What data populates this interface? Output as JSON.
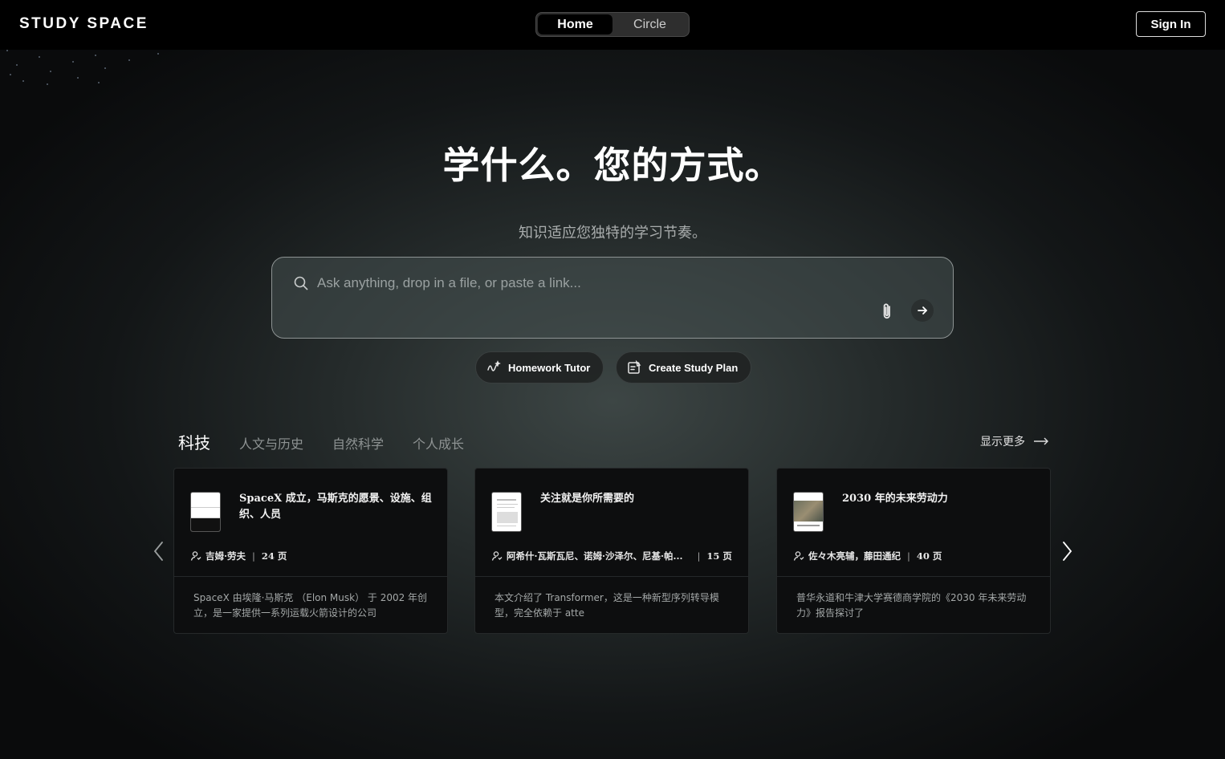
{
  "header": {
    "logo": "STUDY SPACE",
    "tabs": [
      {
        "label": "Home",
        "active": true
      },
      {
        "label": "Circle",
        "active": false
      }
    ],
    "sign_in": "Sign In"
  },
  "hero": {
    "title": "学什么。您的方式。",
    "subtitle": "知识适应您独特的学习节奏。"
  },
  "search": {
    "placeholder": "Ask anything, drop in a file, or paste a link..."
  },
  "chips": [
    {
      "label": "Homework Tutor",
      "icon": "tutor-icon"
    },
    {
      "label": "Create Study Plan",
      "icon": "study-plan-icon"
    }
  ],
  "categories": [
    {
      "label": "科技",
      "active": true
    },
    {
      "label": "人文与历史",
      "active": false
    },
    {
      "label": "自然科学",
      "active": false
    },
    {
      "label": "个人成长",
      "active": false
    }
  ],
  "show_more": "显示更多",
  "cards": [
    {
      "title": "SpaceX 成立，马斯克的愿景、设施、组织、人员",
      "author": "吉姆·劳夫",
      "pages": "24 页",
      "desc": "SpaceX 由埃隆·马斯克 （Elon Musk） 于 2002 年创立，是一家提供一系列运载火箭设计的公司"
    },
    {
      "title": "关注就是你所需要的",
      "author": "阿希什·瓦斯瓦尼、诺姆·沙泽尔、尼基·帕...",
      "pages": "15 页",
      "desc": "本文介绍了 Transformer，这是一种新型序列转导模型，完全依赖于 atte"
    },
    {
      "title": "2030 年的未来劳动力",
      "author": "佐々木亮辅，藤田通纪",
      "pages": "40 页",
      "desc": "普华永道和牛津大学赛德商学院的《2030 年未来劳动力》报告探讨了"
    }
  ],
  "colors": {
    "background": "#0a0b0c",
    "accent": "#ffffff",
    "card_bg": "#0d0e0f"
  }
}
